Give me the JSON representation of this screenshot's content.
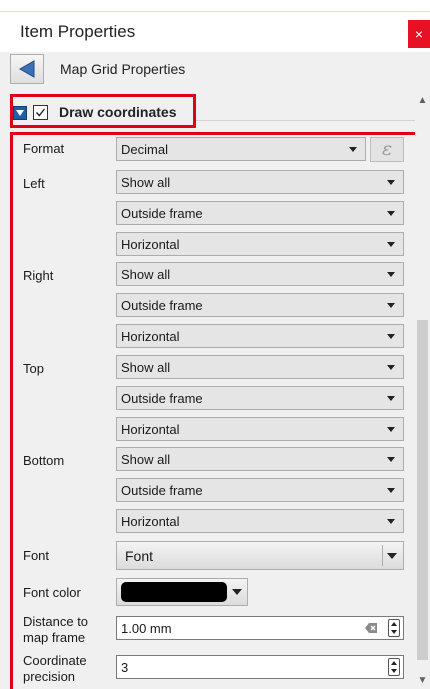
{
  "panel": {
    "title": "Item Properties",
    "close_glyph": "×"
  },
  "subheader": {
    "title": "Map Grid Properties",
    "back_icon": "back-arrow-icon"
  },
  "group": {
    "title": "Draw coordinates",
    "checked": true,
    "expanded": true
  },
  "fields": {
    "format": {
      "label": "Format",
      "value": "Decimal",
      "expression_glyph": "ε"
    },
    "left": {
      "label": "Left",
      "display": "Show all",
      "position": "Outside frame",
      "direction": "Horizontal"
    },
    "right": {
      "label": "Right",
      "display": "Show all",
      "position": "Outside frame",
      "direction": "Horizontal"
    },
    "top": {
      "label": "Top",
      "display": "Show all",
      "position": "Outside frame",
      "direction": "Horizontal"
    },
    "bottom": {
      "label": "Bottom",
      "display": "Show all",
      "position": "Outside frame",
      "direction": "Horizontal"
    },
    "font": {
      "label": "Font",
      "button_label": "Font"
    },
    "font_color": {
      "label": "Font color",
      "color": "#000000"
    },
    "distance": {
      "label_line1": "Distance to",
      "label_line2": "map frame",
      "value": "1.00 mm"
    },
    "precision": {
      "label_line1": "Coordinate",
      "label_line2": "precision",
      "value": "3"
    }
  },
  "colors": {
    "highlight": "#e1001a",
    "close_button": "#e81123",
    "toggle": "#1f5fa8"
  }
}
